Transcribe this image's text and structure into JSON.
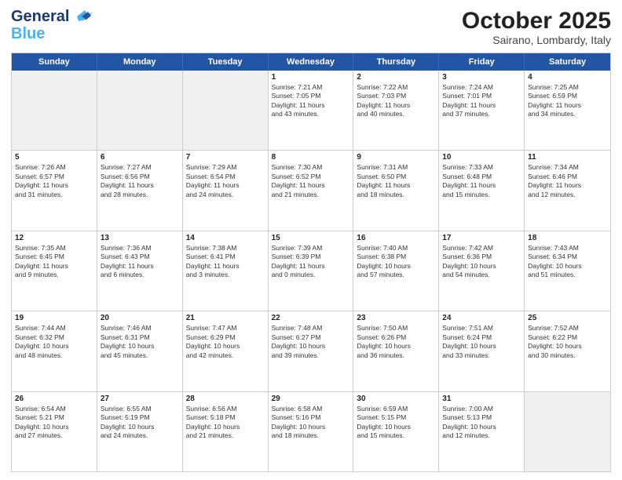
{
  "header": {
    "logo_general": "General",
    "logo_blue": "Blue",
    "title": "October 2025",
    "subtitle": "Sairano, Lombardy, Italy"
  },
  "days_of_week": [
    "Sunday",
    "Monday",
    "Tuesday",
    "Wednesday",
    "Thursday",
    "Friday",
    "Saturday"
  ],
  "weeks": [
    [
      {
        "day": "",
        "lines": [],
        "shaded": true
      },
      {
        "day": "",
        "lines": [],
        "shaded": true
      },
      {
        "day": "",
        "lines": [],
        "shaded": true
      },
      {
        "day": "1",
        "lines": [
          "Sunrise: 7:21 AM",
          "Sunset: 7:05 PM",
          "Daylight: 11 hours",
          "and 43 minutes."
        ],
        "shaded": false
      },
      {
        "day": "2",
        "lines": [
          "Sunrise: 7:22 AM",
          "Sunset: 7:03 PM",
          "Daylight: 11 hours",
          "and 40 minutes."
        ],
        "shaded": false
      },
      {
        "day": "3",
        "lines": [
          "Sunrise: 7:24 AM",
          "Sunset: 7:01 PM",
          "Daylight: 11 hours",
          "and 37 minutes."
        ],
        "shaded": false
      },
      {
        "day": "4",
        "lines": [
          "Sunrise: 7:25 AM",
          "Sunset: 6:59 PM",
          "Daylight: 11 hours",
          "and 34 minutes."
        ],
        "shaded": false
      }
    ],
    [
      {
        "day": "5",
        "lines": [
          "Sunrise: 7:26 AM",
          "Sunset: 6:57 PM",
          "Daylight: 11 hours",
          "and 31 minutes."
        ],
        "shaded": false
      },
      {
        "day": "6",
        "lines": [
          "Sunrise: 7:27 AM",
          "Sunset: 6:56 PM",
          "Daylight: 11 hours",
          "and 28 minutes."
        ],
        "shaded": false
      },
      {
        "day": "7",
        "lines": [
          "Sunrise: 7:29 AM",
          "Sunset: 6:54 PM",
          "Daylight: 11 hours",
          "and 24 minutes."
        ],
        "shaded": false
      },
      {
        "day": "8",
        "lines": [
          "Sunrise: 7:30 AM",
          "Sunset: 6:52 PM",
          "Daylight: 11 hours",
          "and 21 minutes."
        ],
        "shaded": false
      },
      {
        "day": "9",
        "lines": [
          "Sunrise: 7:31 AM",
          "Sunset: 6:50 PM",
          "Daylight: 11 hours",
          "and 18 minutes."
        ],
        "shaded": false
      },
      {
        "day": "10",
        "lines": [
          "Sunrise: 7:33 AM",
          "Sunset: 6:48 PM",
          "Daylight: 11 hours",
          "and 15 minutes."
        ],
        "shaded": false
      },
      {
        "day": "11",
        "lines": [
          "Sunrise: 7:34 AM",
          "Sunset: 6:46 PM",
          "Daylight: 11 hours",
          "and 12 minutes."
        ],
        "shaded": false
      }
    ],
    [
      {
        "day": "12",
        "lines": [
          "Sunrise: 7:35 AM",
          "Sunset: 6:45 PM",
          "Daylight: 11 hours",
          "and 9 minutes."
        ],
        "shaded": false
      },
      {
        "day": "13",
        "lines": [
          "Sunrise: 7:36 AM",
          "Sunset: 6:43 PM",
          "Daylight: 11 hours",
          "and 6 minutes."
        ],
        "shaded": false
      },
      {
        "day": "14",
        "lines": [
          "Sunrise: 7:38 AM",
          "Sunset: 6:41 PM",
          "Daylight: 11 hours",
          "and 3 minutes."
        ],
        "shaded": false
      },
      {
        "day": "15",
        "lines": [
          "Sunrise: 7:39 AM",
          "Sunset: 6:39 PM",
          "Daylight: 11 hours",
          "and 0 minutes."
        ],
        "shaded": false
      },
      {
        "day": "16",
        "lines": [
          "Sunrise: 7:40 AM",
          "Sunset: 6:38 PM",
          "Daylight: 10 hours",
          "and 57 minutes."
        ],
        "shaded": false
      },
      {
        "day": "17",
        "lines": [
          "Sunrise: 7:42 AM",
          "Sunset: 6:36 PM",
          "Daylight: 10 hours",
          "and 54 minutes."
        ],
        "shaded": false
      },
      {
        "day": "18",
        "lines": [
          "Sunrise: 7:43 AM",
          "Sunset: 6:34 PM",
          "Daylight: 10 hours",
          "and 51 minutes."
        ],
        "shaded": false
      }
    ],
    [
      {
        "day": "19",
        "lines": [
          "Sunrise: 7:44 AM",
          "Sunset: 6:32 PM",
          "Daylight: 10 hours",
          "and 48 minutes."
        ],
        "shaded": false
      },
      {
        "day": "20",
        "lines": [
          "Sunrise: 7:46 AM",
          "Sunset: 6:31 PM",
          "Daylight: 10 hours",
          "and 45 minutes."
        ],
        "shaded": false
      },
      {
        "day": "21",
        "lines": [
          "Sunrise: 7:47 AM",
          "Sunset: 6:29 PM",
          "Daylight: 10 hours",
          "and 42 minutes."
        ],
        "shaded": false
      },
      {
        "day": "22",
        "lines": [
          "Sunrise: 7:48 AM",
          "Sunset: 6:27 PM",
          "Daylight: 10 hours",
          "and 39 minutes."
        ],
        "shaded": false
      },
      {
        "day": "23",
        "lines": [
          "Sunrise: 7:50 AM",
          "Sunset: 6:26 PM",
          "Daylight: 10 hours",
          "and 36 minutes."
        ],
        "shaded": false
      },
      {
        "day": "24",
        "lines": [
          "Sunrise: 7:51 AM",
          "Sunset: 6:24 PM",
          "Daylight: 10 hours",
          "and 33 minutes."
        ],
        "shaded": false
      },
      {
        "day": "25",
        "lines": [
          "Sunrise: 7:52 AM",
          "Sunset: 6:22 PM",
          "Daylight: 10 hours",
          "and 30 minutes."
        ],
        "shaded": false
      }
    ],
    [
      {
        "day": "26",
        "lines": [
          "Sunrise: 6:54 AM",
          "Sunset: 5:21 PM",
          "Daylight: 10 hours",
          "and 27 minutes."
        ],
        "shaded": false
      },
      {
        "day": "27",
        "lines": [
          "Sunrise: 6:55 AM",
          "Sunset: 5:19 PM",
          "Daylight: 10 hours",
          "and 24 minutes."
        ],
        "shaded": false
      },
      {
        "day": "28",
        "lines": [
          "Sunrise: 6:56 AM",
          "Sunset: 5:18 PM",
          "Daylight: 10 hours",
          "and 21 minutes."
        ],
        "shaded": false
      },
      {
        "day": "29",
        "lines": [
          "Sunrise: 6:58 AM",
          "Sunset: 5:16 PM",
          "Daylight: 10 hours",
          "and 18 minutes."
        ],
        "shaded": false
      },
      {
        "day": "30",
        "lines": [
          "Sunrise: 6:59 AM",
          "Sunset: 5:15 PM",
          "Daylight: 10 hours",
          "and 15 minutes."
        ],
        "shaded": false
      },
      {
        "day": "31",
        "lines": [
          "Sunrise: 7:00 AM",
          "Sunset: 5:13 PM",
          "Daylight: 10 hours",
          "and 12 minutes."
        ],
        "shaded": false
      },
      {
        "day": "",
        "lines": [],
        "shaded": true
      }
    ]
  ]
}
